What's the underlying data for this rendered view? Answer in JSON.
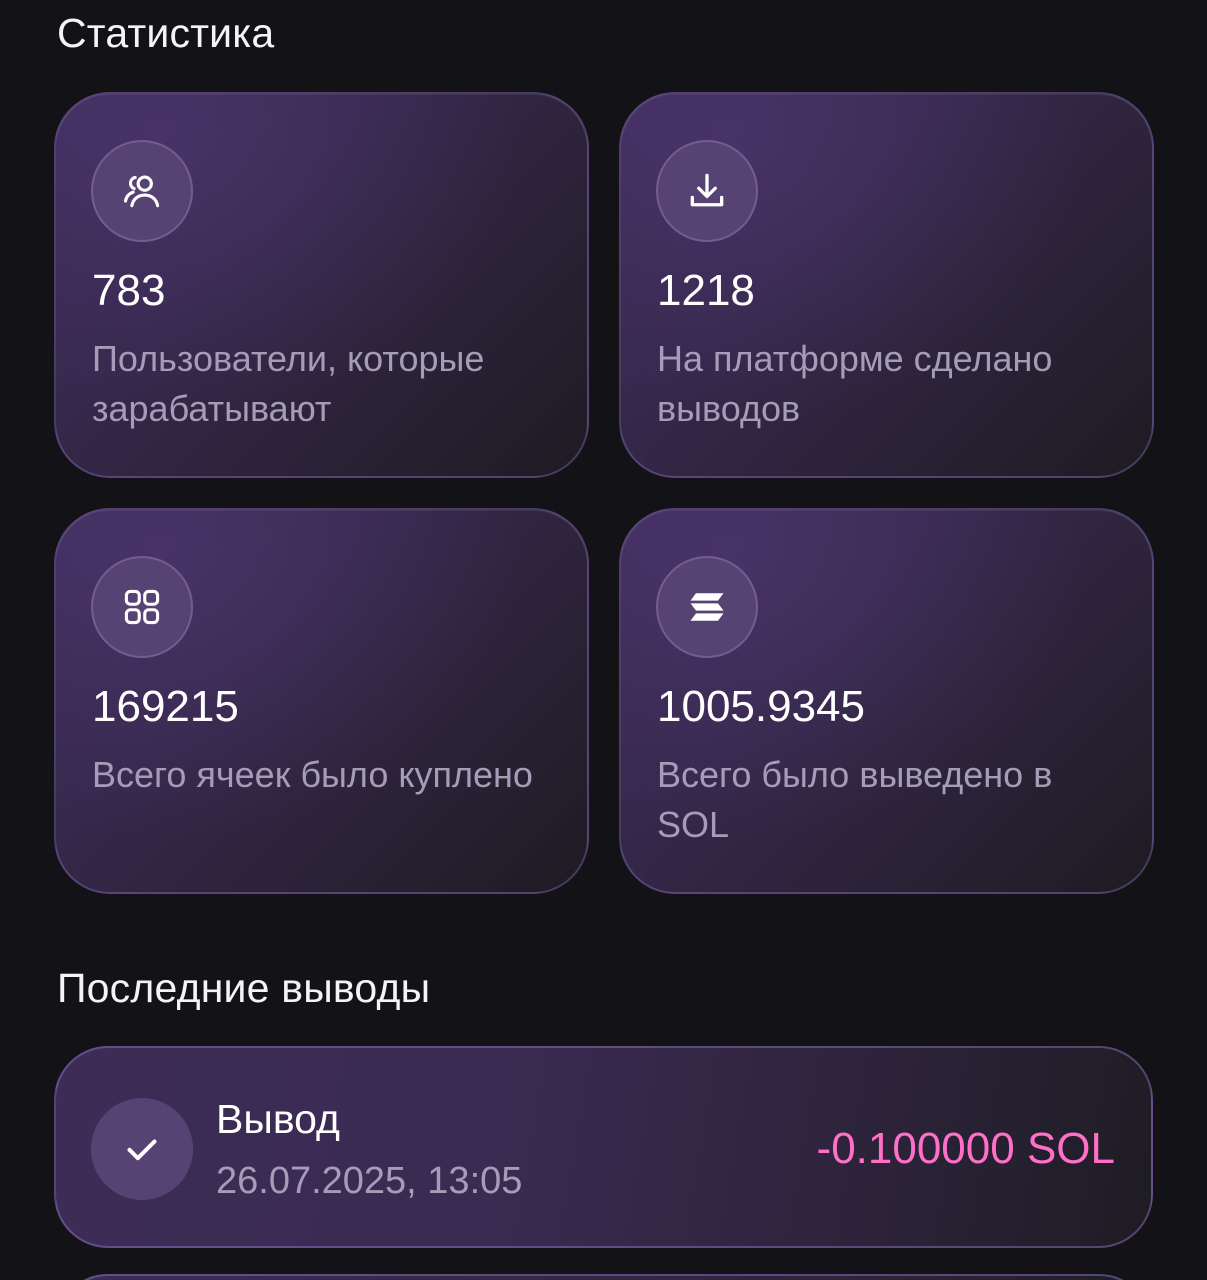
{
  "statistics": {
    "title": "Статистика",
    "cards": [
      {
        "icon": "users-icon",
        "value": "783",
        "description": "Пользователи, которые зарабатывают"
      },
      {
        "icon": "download-icon",
        "value": "1218",
        "description": "На платформе сделано выводов"
      },
      {
        "icon": "grid-icon",
        "value": "169215",
        "description": "Всего ячеек было куплено"
      },
      {
        "icon": "solana-icon",
        "value": "1005.9345",
        "description": "Всего было выведено в SOL"
      }
    ]
  },
  "withdrawals": {
    "title": "Последние выводы",
    "items": [
      {
        "icon": "check-icon",
        "title": "Вывод",
        "date": "26.07.2025, 13:05",
        "amount": "-0.100000 SOL"
      }
    ]
  },
  "colors": {
    "background": "#131317",
    "accent_amount": "#ff6fc8",
    "icon_circle": "#574373",
    "muted_text": "#a59cb8"
  }
}
